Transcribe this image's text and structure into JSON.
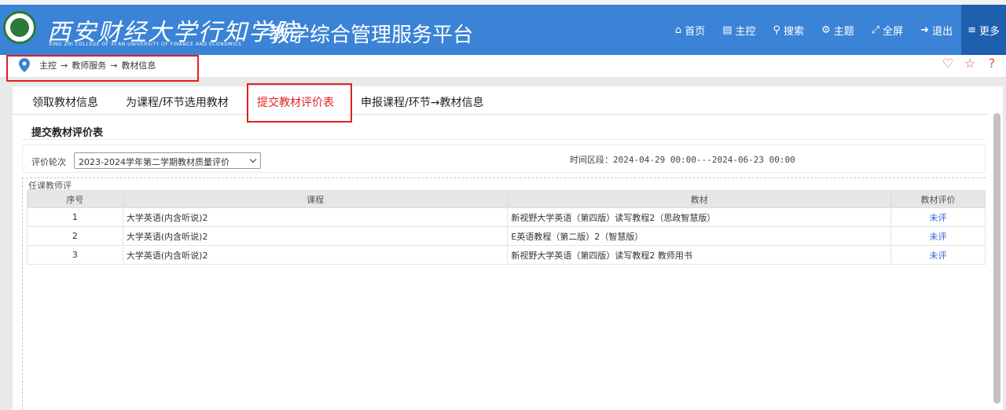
{
  "header": {
    "school_name_cn": "西安财经大学行知学院",
    "school_name_en": "XING ZHI COLLEGE OF XI'AN UNIVERSITY OF FINANCE AND ECONOMICS",
    "platform_title": "教学综合管理服务平台",
    "nav": [
      {
        "icon": "home-icon",
        "label": "首页"
      },
      {
        "icon": "console-icon",
        "label": "主控"
      },
      {
        "icon": "search-icon",
        "label": "搜索"
      },
      {
        "icon": "theme-icon",
        "label": "主题"
      },
      {
        "icon": "fullscreen-icon",
        "label": "全屏"
      },
      {
        "icon": "logout-icon",
        "label": "退出"
      },
      {
        "icon": "menu-icon",
        "label": "更多"
      }
    ],
    "colors": {
      "bar": "#3a83d6",
      "more": "#1e5fae"
    }
  },
  "breadcrumb": {
    "items": [
      "主控",
      "教师服务",
      "教材信息"
    ],
    "separator": "→"
  },
  "tools": [
    "heart-icon",
    "star-icon",
    "help-icon"
  ],
  "tabs": [
    {
      "label": "领取教材信息"
    },
    {
      "label": "为课程/环节选用教材"
    },
    {
      "label": "提交教材评价表",
      "active": true
    },
    {
      "label": "申报课程/环节→教材信息"
    }
  ],
  "section": {
    "title": "提交教材评价表"
  },
  "filter": {
    "label": "评价轮次",
    "selected": "2023-2024学年第二学期教材质量评价",
    "time_range": "时间区段：2024-04-29 00:00---2024-06-23 00:00"
  },
  "table": {
    "legend": "任课教师评",
    "headers": [
      "序号",
      "课程",
      "教材",
      "教材评价"
    ],
    "rows": [
      {
        "no": "1",
        "course": "大学英语(内含听说)2",
        "textbook": "新视野大学英语（第四版）读写教程2（思政智慧版）",
        "status": "未评"
      },
      {
        "no": "2",
        "course": "大学英语(内含听说)2",
        "textbook": "E英语教程（第二版）2（智慧版）",
        "status": "未评"
      },
      {
        "no": "3",
        "course": "大学英语(内含听说)2",
        "textbook": "新视野大学英语（第四版）读写教程2 教师用书",
        "status": "未评"
      }
    ]
  }
}
